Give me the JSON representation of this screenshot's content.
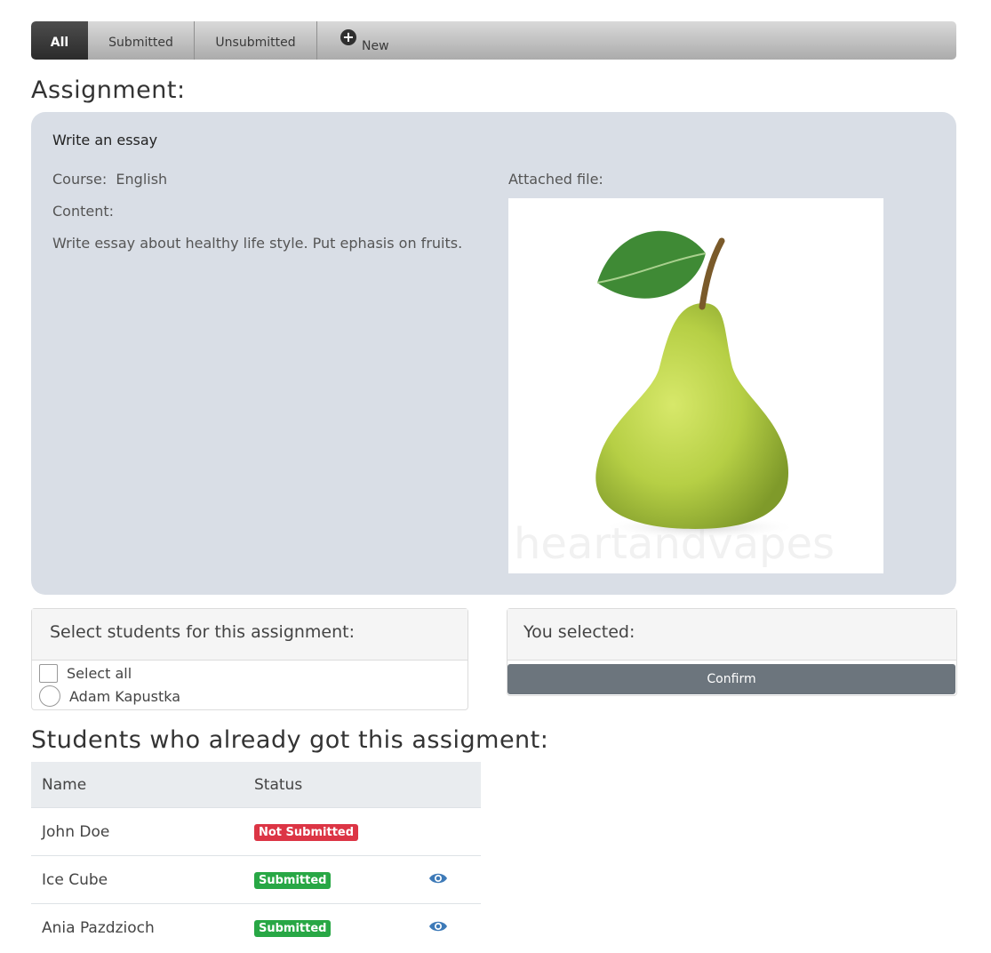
{
  "tabs": [
    {
      "label": "All",
      "active": true
    },
    {
      "label": "Submitted",
      "active": false
    },
    {
      "label": "Unsubmitted",
      "active": false
    },
    {
      "label": "New",
      "icon": "plus-circle-icon"
    }
  ],
  "assignment_heading": "Assignment:",
  "assignment": {
    "title": "Write an essay",
    "course": "Course:  English",
    "content_label": "Content:",
    "content_text": "Write essay about healthy life style. Put ephasis on fruits.",
    "attached_label": "Attached file:",
    "attached_image": "pear-image",
    "watermark": "heartandvapes"
  },
  "select_panel": {
    "header": "Select students for this assignment:",
    "select_all_label": "Select all",
    "students": [
      {
        "name": "Adam Kapustka"
      }
    ]
  },
  "selected_panel": {
    "header": "You selected:",
    "confirm_label": "Confirm"
  },
  "students_heading": "Students who already got this assigment:",
  "table": {
    "columns": [
      "Name",
      "Status",
      ""
    ],
    "rows": [
      {
        "name": "John Doe",
        "status": "Not Submitted",
        "status_color": "#dc3545",
        "view_icon": false
      },
      {
        "name": "Ice Cube",
        "status": "Submitted",
        "status_color": "#28a745",
        "view_icon": true
      },
      {
        "name": "Ania Pazdzioch",
        "status": "Submitted",
        "status_color": "#28a745",
        "view_icon": true
      }
    ]
  },
  "colors": {
    "eye_icon": "#3d7ab8",
    "card_bg": "#d9dee6",
    "confirm_bg": "#6c757d"
  }
}
